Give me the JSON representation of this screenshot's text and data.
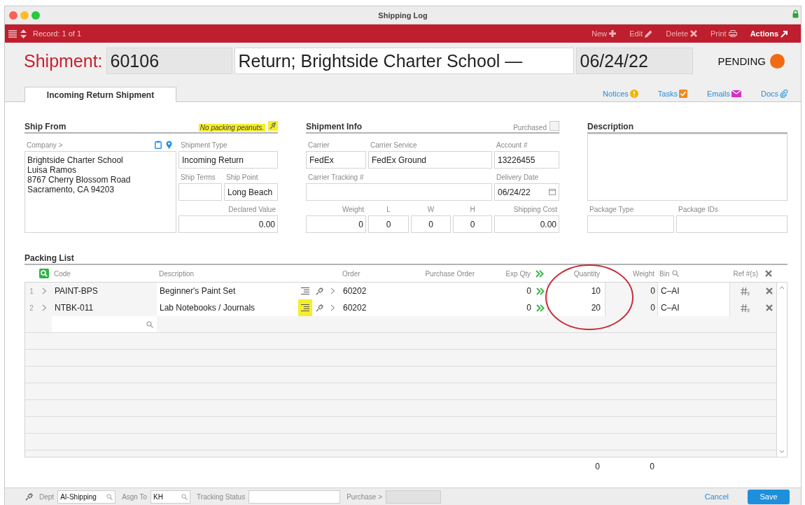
{
  "window": {
    "title": "Shipping Log"
  },
  "toolbar": {
    "record": "Record: 1 of 1",
    "actions": [
      {
        "label": "New",
        "kind": "new",
        "primary": false
      },
      {
        "label": "Edit",
        "kind": "edit",
        "primary": false
      },
      {
        "label": "Delete",
        "kind": "delete",
        "primary": false
      },
      {
        "label": "Print",
        "kind": "print",
        "primary": false
      },
      {
        "label": "Actions",
        "kind": "actions",
        "primary": true
      }
    ]
  },
  "header": {
    "label": "Shipment:",
    "number": "60106",
    "title": "Return; Brightside Charter School —",
    "date": "06/24/22",
    "status": "PENDING"
  },
  "tabs": [
    {
      "label": "Incoming Return Shipment",
      "selected": true
    }
  ],
  "links": [
    {
      "label": "Notices",
      "kind": "notices"
    },
    {
      "label": "Tasks",
      "kind": "tasks"
    },
    {
      "label": "Emails",
      "kind": "emails"
    },
    {
      "label": "Docs",
      "kind": "docs"
    }
  ],
  "ship_from": {
    "title": "Ship From",
    "note": "No packing peanuts.",
    "company_label": "Company >",
    "address": [
      "Brightside Charter School",
      "Luisa Ramos",
      "8767 Cherry Blossom Road",
      "Sacramento, CA 94203"
    ],
    "shipment_type": {
      "label": "Shipment Type",
      "value": "Incoming Return"
    },
    "ship_terms": {
      "label": "Ship Terms"
    },
    "ship_point": {
      "label": "Ship Point",
      "value": "Long Beach"
    },
    "declared_value": {
      "label": "Declared Value",
      "value": "0.00"
    }
  },
  "shipment_info": {
    "title": "Shipment Info",
    "purchased": {
      "label": "Purchased",
      "checked": false
    },
    "carrier": {
      "label": "Carrier",
      "value": "FedEx"
    },
    "carrier_service": {
      "label": "Carrier Service",
      "value": "FedEx Ground"
    },
    "account": {
      "label": "Account #",
      "value": "13226455"
    },
    "tracking": {
      "label": "Carrier Tracking #"
    },
    "delivery_date": {
      "label": "Delivery Date",
      "value": "06/24/22"
    },
    "weight": {
      "label": "Weight",
      "value": "0"
    },
    "l": {
      "label": "L",
      "value": "0"
    },
    "w": {
      "label": "W",
      "value": "0"
    },
    "h": {
      "label": "H",
      "value": "0"
    },
    "shipping_cost": {
      "label": "Shipping Cost",
      "value": "0.00"
    }
  },
  "description": {
    "title": "Description",
    "package_type": {
      "label": "Package Type"
    },
    "package_ids": {
      "label": "Package IDs"
    }
  },
  "packing_list": {
    "title": "Packing List",
    "columns": {
      "code": "Code",
      "description": "Description",
      "order": "Order",
      "purchase_order": "Purchase Order",
      "exp_qty": "Exp Qty",
      "quantity": "Quantity",
      "weight": "Weight",
      "bin": "Bin",
      "ref": "Ref #(s)"
    },
    "rows": [
      {
        "number": "1",
        "code": "PAINT-BPS",
        "description": "Beginner's Paint Set",
        "notes": false,
        "order": "60202",
        "exp_qty": "0",
        "quantity": "10",
        "weight": "0",
        "bin": "C–AI"
      },
      {
        "number": "2",
        "code": "NTBK-011",
        "description": "Lab Notebooks / Journals",
        "notes": true,
        "order": "60202",
        "exp_qty": "0",
        "quantity": "20",
        "weight": "0",
        "bin": "C–AI"
      }
    ],
    "totals": {
      "quantity": "0",
      "weight": "0"
    },
    "annotation": {
      "kind": "ellipse"
    }
  },
  "footer": {
    "dept": {
      "label": "Dept",
      "value": "AI-Shipping"
    },
    "assign": {
      "label": "Asgn To",
      "value": "KH"
    },
    "tracking_status": {
      "label": "Tracking Status"
    },
    "purchase": {
      "label": "Purchase >",
      "disabled": true
    },
    "cancel": "Cancel",
    "save": "Save"
  }
}
